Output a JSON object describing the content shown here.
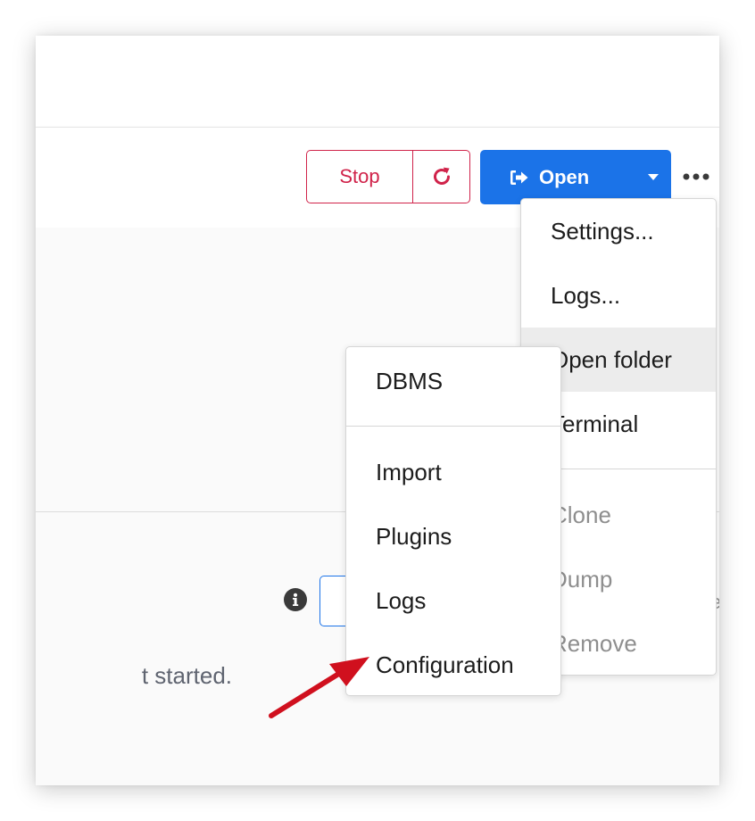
{
  "toolbar": {
    "stop_label": "Stop",
    "restart_icon": "restart-icon",
    "open_label": "Open",
    "open_icon": "sign-in-icon",
    "open_dropdown_icon": "caret-down-icon",
    "more_icon": "more-horizontal-icon"
  },
  "actions_menu": {
    "items": [
      {
        "label": "Settings...",
        "disabled": false,
        "highlighted": false
      },
      {
        "label": "Logs...",
        "disabled": false,
        "highlighted": false
      },
      {
        "label": "Open folder",
        "disabled": false,
        "highlighted": true
      },
      {
        "label": "Terminal",
        "disabled": false,
        "highlighted": false
      },
      {
        "label": "Clone",
        "disabled": true,
        "highlighted": false
      },
      {
        "label": "Dump",
        "disabled": true,
        "highlighted": false
      },
      {
        "label": "Remove",
        "disabled": true,
        "highlighted": false
      }
    ]
  },
  "open_folder_submenu": {
    "items": [
      {
        "label": "DBMS"
      },
      {
        "label": "Import"
      },
      {
        "label": "Plugins"
      },
      {
        "label": "Logs"
      },
      {
        "label": "Configuration"
      }
    ]
  },
  "status": {
    "text": "t started.",
    "info_icon": "info-icon",
    "edge_text": "e"
  },
  "colors": {
    "danger": "#d0234a",
    "primary": "#1b73e8",
    "annotation_arrow": "#d0101e",
    "disabled_text": "#8e8e8e"
  }
}
